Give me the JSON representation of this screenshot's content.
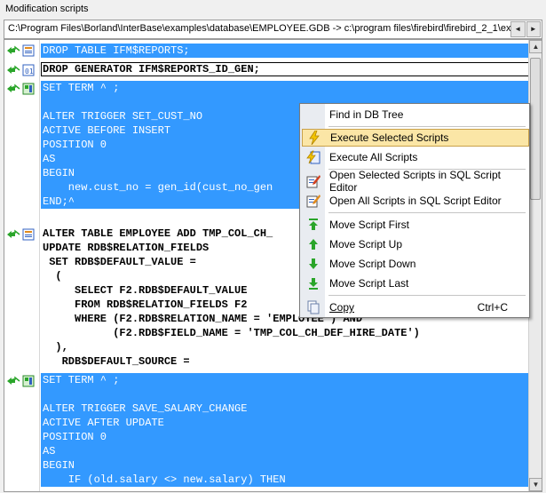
{
  "panel": {
    "title": "Modification scripts"
  },
  "path_bar": {
    "text": "C:\\Program Files\\Borland\\InterBase\\examples\\database\\EMPLOYEE.GDB -> c:\\program files\\firebird\\firebird_2_1\\examp",
    "left_arrow": "◄",
    "right_arrow": "►"
  },
  "blocks": [
    {
      "lines": [
        "DROP TABLE IFM$REPORTS;"
      ]
    },
    {
      "lines": [
        "DROP GENERATOR IFM$REPORTS_ID_GEN;"
      ]
    },
    {
      "lines": [
        "SET TERM ^ ;",
        "",
        "ALTER TRIGGER SET_CUST_NO",
        "ACTIVE BEFORE INSERT",
        "POSITION 0",
        "AS",
        "BEGIN",
        "    new.cust_no = gen_id(cust_no_gen",
        "END;^"
      ]
    },
    {
      "lines": [
        "ALTER TABLE EMPLOYEE ADD TMP_COL_CH_",
        "UPDATE RDB$RELATION_FIELDS",
        " SET RDB$DEFAULT_VALUE =",
        "  (",
        "     SELECT F2.RDB$DEFAULT_VALUE",
        "     FROM RDB$RELATION_FIELDS F2",
        "     WHERE (F2.RDB$RELATION_NAME = 'EMPLOYEE') AND",
        "           (F2.RDB$FIELD_NAME = 'TMP_COL_CH_DEF_HIRE_DATE')",
        "  ),",
        "   RDB$DEFAULT_SOURCE ="
      ]
    },
    {
      "lines": [
        "SET TERM ^ ;",
        "",
        "ALTER TRIGGER SAVE_SALARY_CHANGE",
        "ACTIVE AFTER UPDATE",
        "POSITION 0",
        "AS",
        "BEGIN",
        "    IF (old.salary <> new.salary) THEN"
      ]
    }
  ],
  "context_menu": {
    "items": [
      {
        "label": "Find in DB Tree",
        "icon": "none"
      },
      {
        "label": "Execute Selected Scripts",
        "icon": "lightning-icon",
        "highlighted": true
      },
      {
        "label": "Execute All Scripts",
        "icon": "lightning-page-icon"
      },
      {
        "label": "Open Selected Scripts in SQL Script Editor",
        "icon": "edit-script-icon"
      },
      {
        "label": "Open All Scripts in SQL Script Editor",
        "icon": "edit-all-icon"
      },
      {
        "label": "Move Script First",
        "icon": "arrow-first-icon"
      },
      {
        "label": "Move Script Up",
        "icon": "arrow-up-icon"
      },
      {
        "label": "Move Script Down",
        "icon": "arrow-down-icon"
      },
      {
        "label": "Move Script Last",
        "icon": "arrow-last-icon"
      },
      {
        "label": "Copy",
        "icon": "copy-icon",
        "shortcut": "Ctrl+C"
      }
    ]
  },
  "colors": {
    "selection": "#3399ff",
    "highlight": "#fbe6a6",
    "arrow_green": "#2aa52a"
  }
}
